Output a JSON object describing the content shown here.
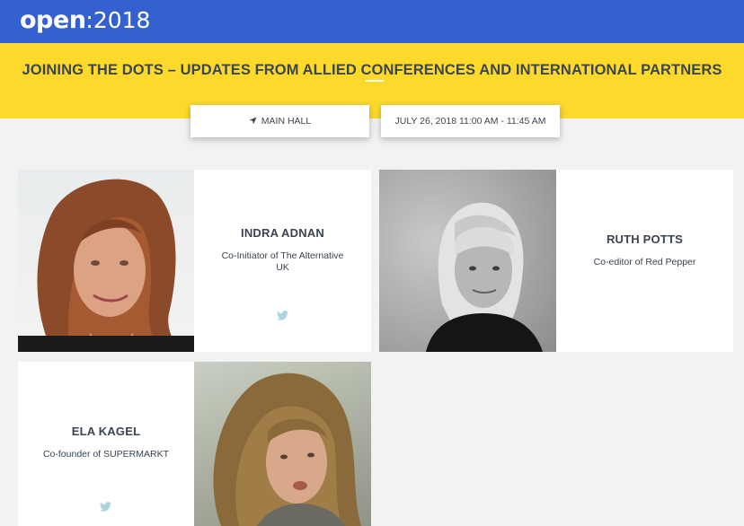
{
  "header": {
    "logo_word": "open",
    "logo_year": ":2018",
    "brand_color": "#3561d0",
    "banner_color": "#fcd92a"
  },
  "session": {
    "title": "JOINING THE DOTS – UPDATES FROM ALLIED CONFERENCES AND INTERNATIONAL PARTNERS",
    "location": "MAIN HALL",
    "location_icon": "location-arrow-icon",
    "datetime": "JULY 26, 2018 11:00 AM - 11:45 AM"
  },
  "speakers": [
    {
      "name": "INDRA ADNAN",
      "role": "Co-Initiator of The Alternative UK",
      "social_icon": "twitter-icon"
    },
    {
      "name": "RUTH POTTS",
      "role": "Co-editor of Red Pepper"
    },
    {
      "name": "ELA KAGEL",
      "role": "Co-founder of SUPERMARKT",
      "social_icon": "twitter-icon"
    }
  ],
  "colors": {
    "twitter": "#a9d4e0",
    "text": "#3a4450"
  }
}
